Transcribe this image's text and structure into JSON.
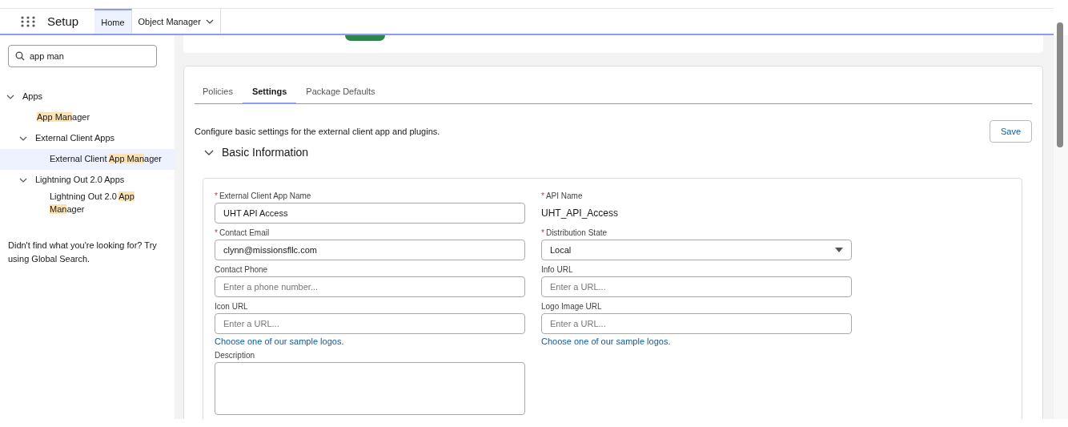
{
  "header": {
    "app_name": "Setup",
    "nav": [
      {
        "label": "Home",
        "selected": true,
        "dropdown": false
      },
      {
        "label": "Object Manager",
        "selected": false,
        "dropdown": true
      }
    ]
  },
  "sidebar": {
    "search": {
      "value": "app man"
    },
    "tree": [
      {
        "segments": [
          {
            "text": "Apps",
            "match": false
          }
        ],
        "expanded": true,
        "selected": false,
        "children": [
          {
            "segments": [
              {
                "text": "App Man",
                "match": true
              },
              {
                "text": "ager",
                "match": false
              }
            ],
            "selected": false
          },
          {
            "segments": [
              {
                "text": "External Client Apps",
                "match": false
              }
            ],
            "expanded": true,
            "selected": false,
            "children": [
              {
                "segments": [
                  {
                    "text": "External Client ",
                    "match": false
                  },
                  {
                    "text": "App Man",
                    "match": true
                  },
                  {
                    "text": "ager",
                    "match": false
                  }
                ],
                "selected": true
              }
            ]
          },
          {
            "segments": [
              {
                "text": "Lightning Out 2.0 Apps",
                "match": false
              }
            ],
            "expanded": true,
            "selected": false,
            "children": [
              {
                "segments": [
                  {
                    "text": "Lightning Out 2.0 ",
                    "match": false
                  },
                  {
                    "text": "App Man",
                    "match": true
                  },
                  {
                    "text": "ager",
                    "match": false
                  }
                ],
                "selected": false
              }
            ]
          }
        ]
      }
    ],
    "help": "Didn't find what you're looking for? Try using Global Search."
  },
  "tabs": [
    {
      "label": "Policies",
      "selected": false
    },
    {
      "label": "Settings",
      "selected": true
    },
    {
      "label": "Package Defaults",
      "selected": false
    }
  ],
  "description": "Configure basic settings for the external client app and plugins.",
  "save_button": "Save",
  "section": {
    "title": "Basic Information",
    "expanded": true,
    "columns": [
      [
        {
          "kind": "input",
          "required_mark": "*",
          "label": "External Client App Name",
          "value": "UHT API Access"
        },
        {
          "kind": "input",
          "required_mark": "*",
          "label": "Contact Email",
          "value": "clynn@missionsfllc.com"
        },
        {
          "kind": "input",
          "label": "Contact Phone",
          "placeholder": "Enter a phone number..."
        },
        {
          "kind": "input",
          "label": "Icon URL",
          "placeholder": "Enter a URL...",
          "link": "Choose one of our sample logos."
        },
        {
          "kind": "textarea",
          "label": "Description"
        }
      ],
      [
        {
          "kind": "text",
          "required_mark": "*",
          "label": "API Name",
          "value": "UHT_API_Access"
        },
        {
          "kind": "select",
          "required_mark": "*",
          "label": "Distribution State",
          "value": "Local"
        },
        {
          "kind": "input",
          "label": "Info URL",
          "placeholder": "Enter a URL..."
        },
        {
          "kind": "input",
          "label": "Logo Image URL",
          "placeholder": "Enter a URL...",
          "link": "Choose one of our sample logos."
        }
      ]
    ]
  }
}
